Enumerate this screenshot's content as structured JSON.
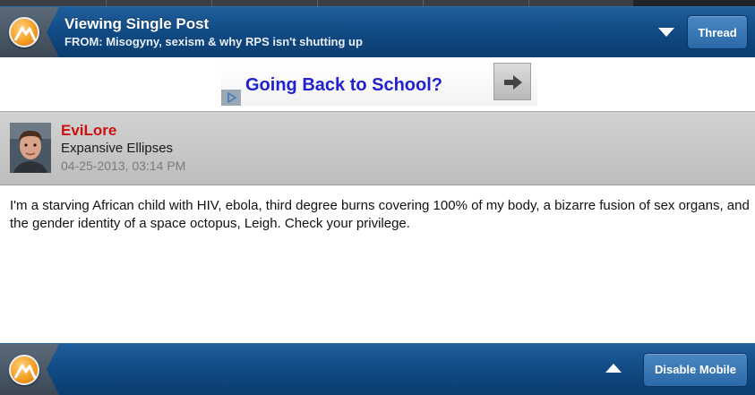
{
  "header": {
    "title": "Viewing Single Post",
    "subtitle": "FROM: Misogyny, sexism & why RPS isn't shutting up",
    "thread_button": "Thread",
    "menu_icon": "triangle-down-icon",
    "logo_icon": "forum-logo-icon"
  },
  "ad": {
    "text": "Going Back to School?",
    "arrow_icon": "arrow-right-icon",
    "adchoices_icon": "adchoices-icon",
    "text_color": "#2222cc"
  },
  "post": {
    "username": "EviLore",
    "user_title": "Expansive Ellipses",
    "date": "04-25-2013, 03:14 PM",
    "body": "I'm a starving African child with HIV, ebola, third degree burns covering 100% of my body, a bizarre fusion of sex organs, and the gender identity of a space octopus, Leigh. Check your privilege.",
    "username_color": "#cc1010"
  },
  "footer": {
    "disable_mobile_button": "Disable Mobile",
    "scroll_top_icon": "triangle-up-icon",
    "logo_icon": "forum-logo-icon"
  },
  "colors": {
    "navbar": "#114a84",
    "button": "#2b6aa8"
  }
}
